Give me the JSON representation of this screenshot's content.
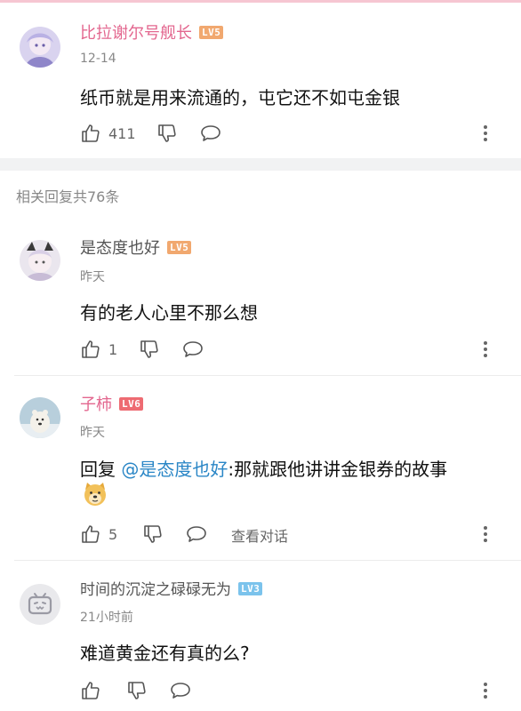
{
  "main_comment": {
    "username": "比拉谢尔号舰长",
    "level": "LV5",
    "level_color": "#f1a86f",
    "time": "12-14",
    "text": "纸币就是用来流通的，屯它还不如屯金银",
    "likes": "411"
  },
  "replies_header": "相关回复共76条",
  "replies": [
    {
      "username": "是态度也好",
      "level": "LV5",
      "level_color": "#f1a86f",
      "time": "昨天",
      "text": "有的老人心里不那么想",
      "likes": "1"
    },
    {
      "username": "子柿",
      "level": "LV6",
      "level_color": "#ee6b72",
      "time": "昨天",
      "reply_prefix": "回复 ",
      "mention": "@是态度也好",
      "text": ":那就跟他讲讲金银券的故事",
      "emoji": "doge",
      "likes": "5",
      "view_conversation": "查看对话"
    },
    {
      "username": "时间的沉淀之碌碌无为",
      "level": "LV3",
      "level_color": "#7bc3ec",
      "time": "21小时前",
      "text": "难道黄金还有真的么?"
    }
  ],
  "icons": [
    "thumb-up-icon",
    "thumb-down-icon",
    "comment-bubble-icon",
    "more-vertical-icon"
  ]
}
